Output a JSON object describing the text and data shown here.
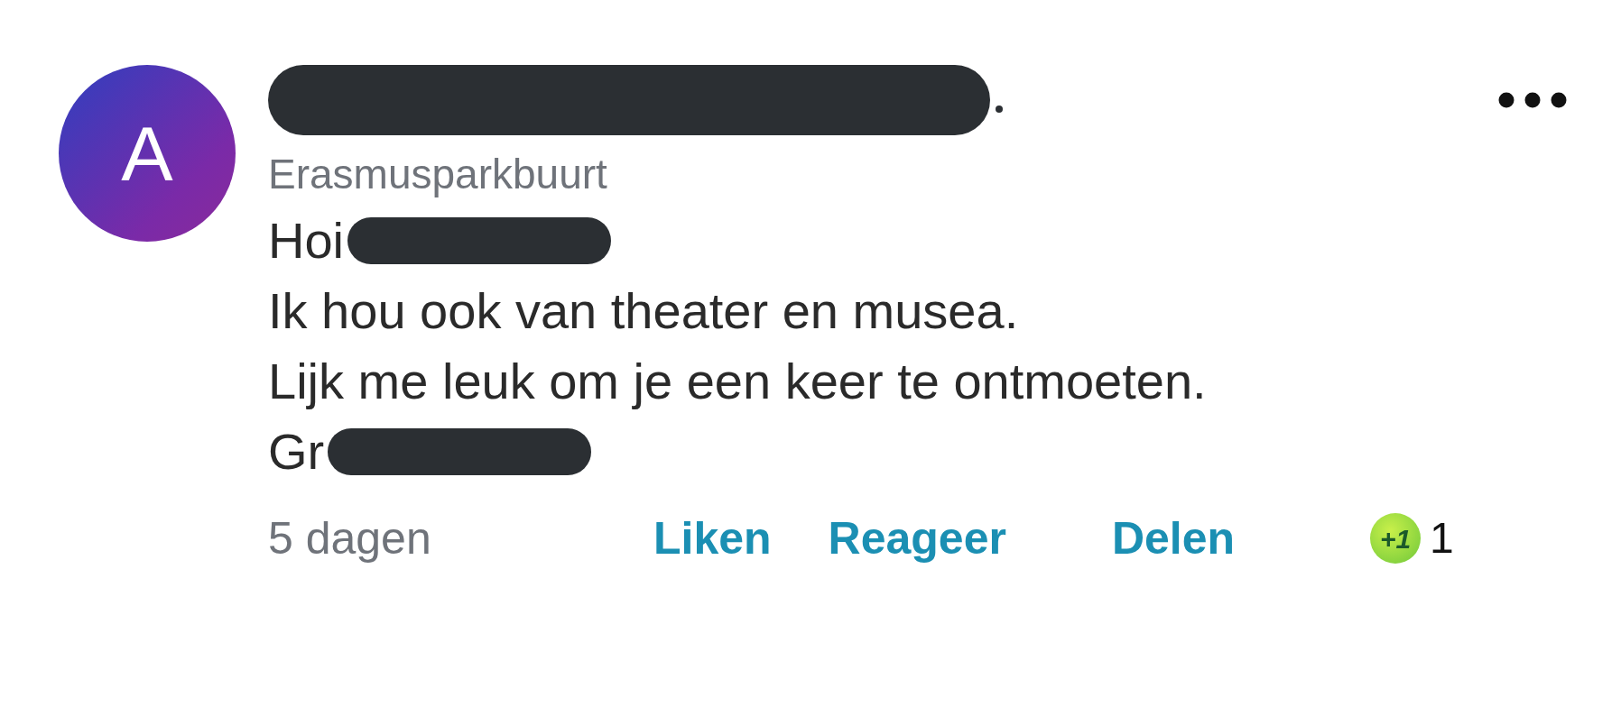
{
  "avatar": {
    "initial": "A"
  },
  "author": {
    "redacted": true
  },
  "location": "Erasmusparkbuurt",
  "body_lines": [
    {
      "text": "Hoi",
      "redacted": true
    },
    {
      "text": "Ik hou ook van theater en musea.",
      "redacted": false
    },
    {
      "text": "Lijk me leuk om je een keer te ontmoeten.",
      "redacted": false
    },
    {
      "text": "Gr",
      "redacted": true
    }
  ],
  "time": "5 dagen",
  "actions": [
    "Liken",
    "Reageer",
    "Delen"
  ],
  "reaction": {
    "badge": "+1",
    "count": "1"
  }
}
